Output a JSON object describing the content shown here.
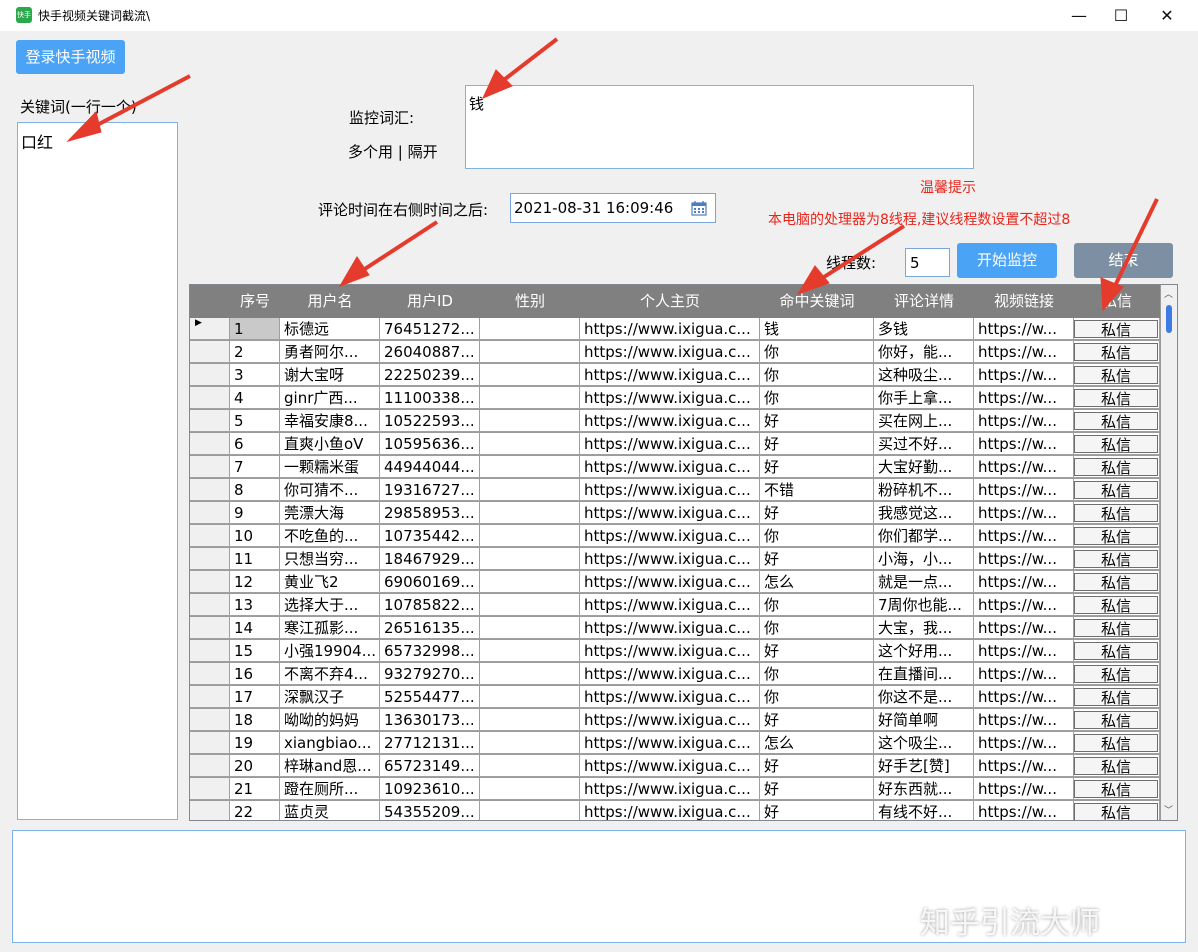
{
  "window": {
    "title": "快手视频关键词截流\\",
    "minimize": "—",
    "maximize": "☐",
    "close": "✕"
  },
  "login_button": "登录快手视频",
  "keywords": {
    "label": "关键词(一行一个)",
    "value": "口红"
  },
  "monitor": {
    "label": "监控词汇:",
    "hint": "多个用 | 隔开",
    "value": "钱"
  },
  "comment_time": {
    "label": "评论时间在右侧时间之后:",
    "value": "2021-08-31 16:09:46"
  },
  "tip": {
    "title": "温馨提示",
    "text": "本电脑的处理器为8线程,建议线程数设置不超过8"
  },
  "threads": {
    "label": "线程数:",
    "value": "5"
  },
  "start_button": "开始监控",
  "stop_button": "结束",
  "table": {
    "headers": [
      "序号",
      "用户名",
      "用户ID",
      "性别",
      "个人主页",
      "命中关键词",
      "评论详情",
      "视频链接",
      "私信"
    ],
    "rows": [
      [
        "1",
        "标德远",
        "76451272...",
        "",
        "https://www.ixigua.c...",
        "钱",
        "多钱",
        "https://w...",
        "私信"
      ],
      [
        "2",
        "勇者阿尔...",
        "26040887...",
        "",
        "https://www.ixigua.c...",
        "你",
        "你好，能...",
        "https://w...",
        "私信"
      ],
      [
        "3",
        "谢大宝呀",
        "22250239...",
        "",
        "https://www.ixigua.c...",
        "你",
        "这种吸尘...",
        "https://w...",
        "私信"
      ],
      [
        "4",
        "ginr广西...",
        "11100338...",
        "",
        "https://www.ixigua.c...",
        "你",
        "你手上拿...",
        "https://w...",
        "私信"
      ],
      [
        "5",
        "幸福安康8...",
        "10522593...",
        "",
        "https://www.ixigua.c...",
        "好",
        "买在网上...",
        "https://w...",
        "私信"
      ],
      [
        "6",
        "直爽小鱼oV",
        "10595636...",
        "",
        "https://www.ixigua.c...",
        "好",
        "买过不好...",
        "https://w...",
        "私信"
      ],
      [
        "7",
        "一颗糯米蛋",
        "44944044...",
        "",
        "https://www.ixigua.c...",
        "好",
        "大宝好勤...",
        "https://w...",
        "私信"
      ],
      [
        "8",
        "你可猜不...",
        "19316727...",
        "",
        "https://www.ixigua.c...",
        "不错",
        "粉碎机不...",
        "https://w...",
        "私信"
      ],
      [
        "9",
        "莞漂大海",
        "29858953...",
        "",
        "https://www.ixigua.c...",
        "好",
        "我感觉这...",
        "https://w...",
        "私信"
      ],
      [
        "10",
        "不吃鱼的...",
        "10735442...",
        "",
        "https://www.ixigua.c...",
        "你",
        "你们都学...",
        "https://w...",
        "私信"
      ],
      [
        "11",
        "只想当穷...",
        "18467929...",
        "",
        "https://www.ixigua.c...",
        "好",
        "小海，小...",
        "https://w...",
        "私信"
      ],
      [
        "12",
        "黄业飞2",
        "69060169...",
        "",
        "https://www.ixigua.c...",
        "怎么",
        "就是一点...",
        "https://w...",
        "私信"
      ],
      [
        "13",
        "选择大于...",
        "10785822...",
        "",
        "https://www.ixigua.c...",
        "你",
        "7周你也能...",
        "https://w...",
        "私信"
      ],
      [
        "14",
        "寒江孤影...",
        "26516135...",
        "",
        "https://www.ixigua.c...",
        "你",
        "大宝，我...",
        "https://w...",
        "私信"
      ],
      [
        "15",
        "小强19904...",
        "65732998...",
        "",
        "https://www.ixigua.c...",
        "好",
        "这个好用...",
        "https://w...",
        "私信"
      ],
      [
        "16",
        "不离不弃4...",
        "93279270...",
        "",
        "https://www.ixigua.c...",
        "你",
        "在直播间...",
        "https://w...",
        "私信"
      ],
      [
        "17",
        "深飘汉子",
        "52554477...",
        "",
        "https://www.ixigua.c...",
        "你",
        "你这不是...",
        "https://w...",
        "私信"
      ],
      [
        "18",
        "呦呦的妈妈",
        "13630173...",
        "",
        "https://www.ixigua.c...",
        "好",
        "好简单啊",
        "https://w...",
        "私信"
      ],
      [
        "19",
        "xiangbiao...",
        "27712131...",
        "",
        "https://www.ixigua.c...",
        "怎么",
        "这个吸尘...",
        "https://w...",
        "私信"
      ],
      [
        "20",
        "梓琳and恩...",
        "65723149...",
        "",
        "https://www.ixigua.c...",
        "好",
        "好手艺[赞]",
        "https://w...",
        "私信"
      ],
      [
        "21",
        "蹬在厕所...",
        "10923610...",
        "",
        "https://www.ixigua.c...",
        "好",
        "好东西就...",
        "https://w...",
        "私信"
      ],
      [
        "22",
        "蓝贞灵",
        "54355209...",
        "",
        "https://www.ixigua.c...",
        "好",
        "有线不好...",
        "https://w...",
        "私信"
      ]
    ]
  },
  "watermark": "知乎引流大师",
  "colors": {
    "accent": "#4ba3f5",
    "tip_red": "#e8261c",
    "arrow_red": "#e53b2c"
  }
}
